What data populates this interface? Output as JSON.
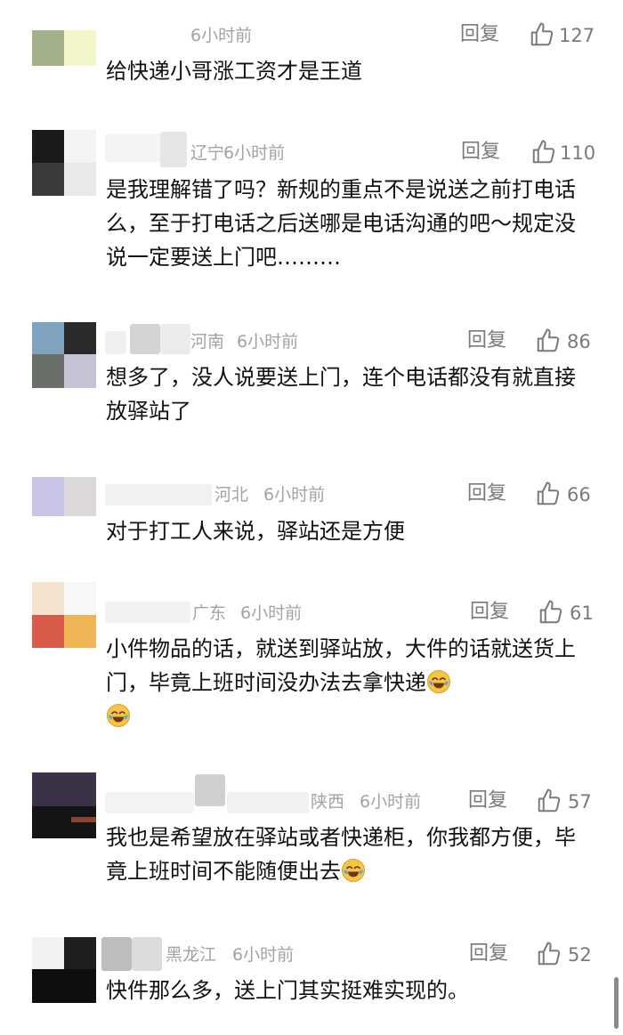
{
  "comments": [
    {
      "region": "",
      "time": "6小时前",
      "reply": "回复",
      "likes": "127",
      "text": "给快递小哥涨工资才是王道"
    },
    {
      "region": "辽宁",
      "time": "6小时前",
      "reply": "回复",
      "likes": "110",
      "text": "是我理解错了吗？新规的重点不是说送之前打电话么，至于打电话之后送哪是电话沟通的吧～规定没说一定要送上门吧………"
    },
    {
      "region": "河南",
      "time": "6小时前",
      "reply": "回复",
      "likes": "86",
      "text": "想多了，没人说要送上门，连个电话都没有就直接放驿站了"
    },
    {
      "region": "河北",
      "time": "6小时前",
      "reply": "回复",
      "likes": "66",
      "text": "对于打工人来说，驿站还是方便"
    },
    {
      "region": "广东",
      "time": "6小时前",
      "reply": "回复",
      "likes": "61",
      "text": "小件物品的话，就送到驿站放，大件的话就送货上门，毕竟上班时间没办法去拿快递"
    },
    {
      "region": "陕西",
      "time": "6小时前",
      "reply": "回复",
      "likes": "57",
      "text": "我也是希望放在驿站或者快递柜，你我都方便，毕竟上班时间不能随便出去"
    },
    {
      "region": "黑龙江",
      "time": "6小时前",
      "reply": "回复",
      "likes": "52",
      "text": "快件那么多，送上门其实挺难实现的。"
    }
  ],
  "icons": {
    "like": "thumbs-up-outline-icon",
    "emoji_cry_laugh": "face-with-tears-of-joy-icon"
  },
  "colors": {
    "meta": "#a3a3a3",
    "action": "#7a7a7a",
    "text": "#111111"
  }
}
